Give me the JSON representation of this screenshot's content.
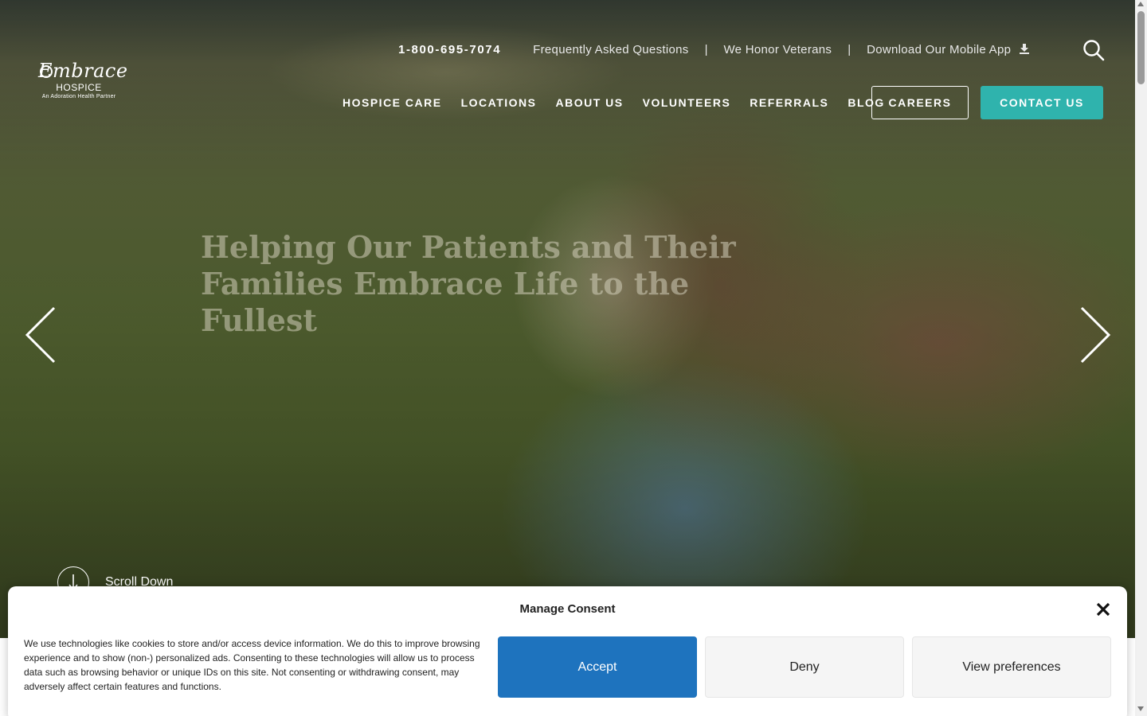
{
  "brand": {
    "logo_script": "Embrace",
    "logo_sub": "HOSPICE",
    "logo_tagline": "An Adoration Health Partner"
  },
  "topbar": {
    "phone": "1-800-695-7074",
    "links": [
      "Frequently Asked Questions",
      "We Honor Veterans",
      "Download Our Mobile App"
    ],
    "separator": "|"
  },
  "nav": {
    "items": [
      "HOSPICE CARE",
      "LOCATIONS",
      "ABOUT US",
      "VOLUNTEERS",
      "REFERRALS",
      "BLOG"
    ],
    "careers": "CAREERS",
    "contact": "CONTACT US"
  },
  "hero": {
    "title_line1": "Helping Our Patients and Their",
    "title_line2": "Families Embrace Life to the Fullest",
    "scroll_label": "Scroll Down"
  },
  "consent": {
    "title": "Manage Consent",
    "text": "We use technologies like cookies to store and/or access device information. We do this to improve browsing experience and to show (non-) personalized ads. Consenting to these technologies will allow us to process data such as browsing behavior or unique IDs on this site. Not consenting or withdrawing consent, may adversely affect certain features and functions.",
    "accept": "Accept",
    "deny": "Deny",
    "preferences": "View preferences"
  },
  "colors": {
    "accent_teal": "#2fb3ad",
    "accept_blue": "#1e73be"
  },
  "icons": [
    "search-icon",
    "download-icon",
    "chevron-left-icon",
    "chevron-right-icon",
    "arrow-down-icon",
    "close-icon"
  ]
}
